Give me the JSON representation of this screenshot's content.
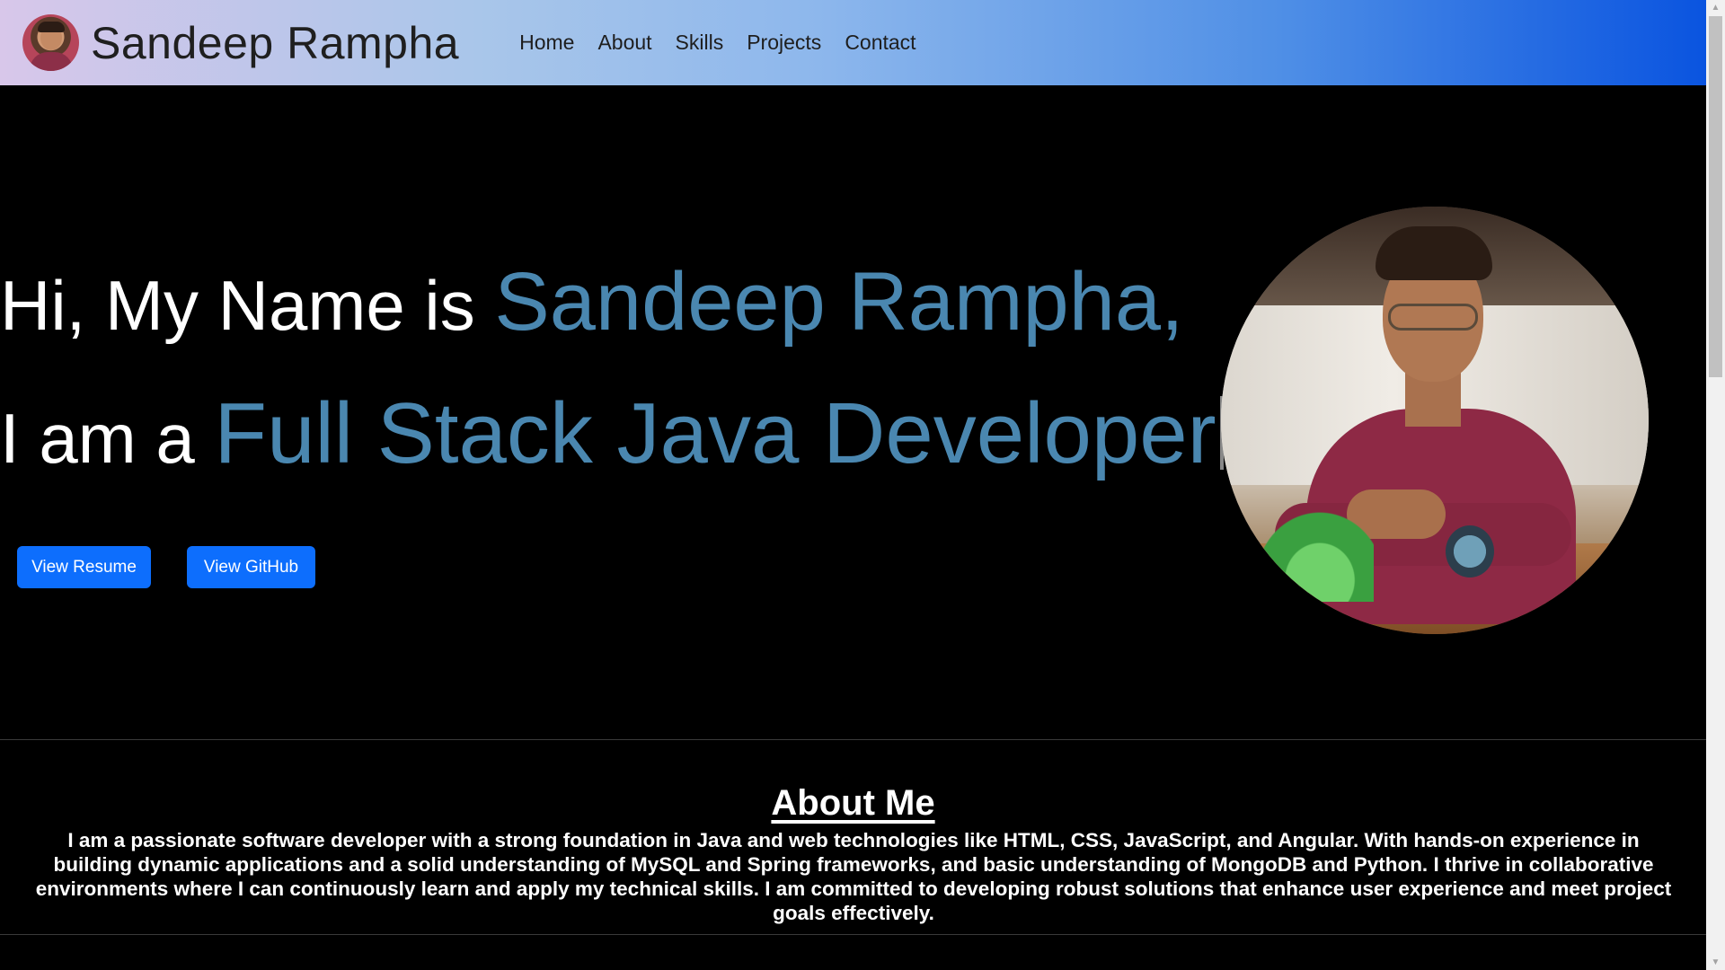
{
  "navbar": {
    "brand_name": "Sandeep Rampha",
    "links": [
      "Home",
      "About",
      "Skills",
      "Projects",
      "Contact"
    ]
  },
  "hero": {
    "line1_prefix": "Hi, My Name is ",
    "line1_accent": "Sandeep Rampha,",
    "line2_prefix": "I am a ",
    "line2_accent": "Full Stack Java Developer",
    "buttons": {
      "resume": "View Resume",
      "github": "View GitHub"
    }
  },
  "about": {
    "title": "About Me",
    "text": "I am a passionate software developer with a strong foundation in Java and web technologies like HTML, CSS, JavaScript, and Angular. With hands-on experience in building dynamic applications and a solid understanding of MySQL and Spring frameworks, and basic understanding of MongoDB and Python. I thrive in collaborative environments where I can continuously learn and apply my technical skills. I am committed to developing robust solutions that enhance user experience and meet project goals effectively."
  },
  "colors": {
    "accent_text": "#4a87b0",
    "button_primary": "#0d6efd",
    "background": "#000000"
  }
}
